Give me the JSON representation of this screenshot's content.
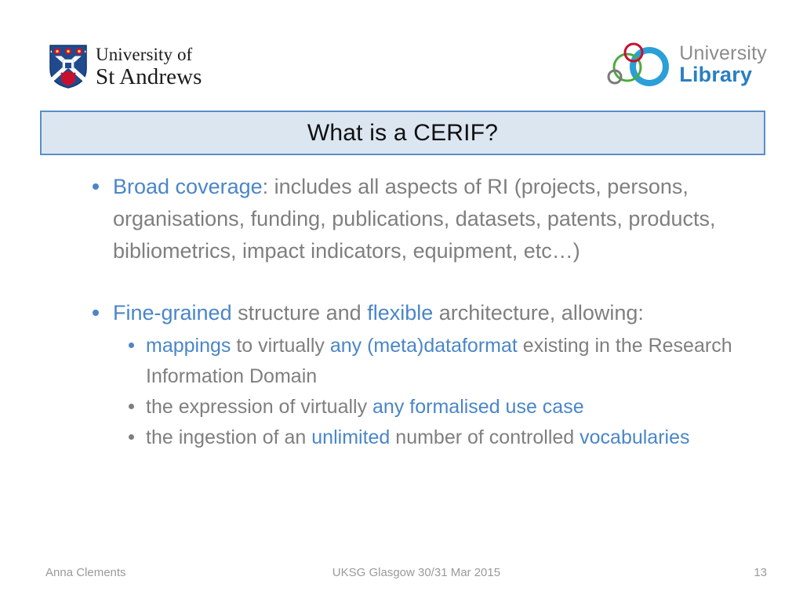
{
  "header": {
    "st_andrews": {
      "line1": "University of",
      "line2": "St Andrews",
      "crest_alt": "st-andrews-crest"
    },
    "library": {
      "line1": "University",
      "line2": "Library",
      "rings_alt": "library-rings-logo"
    }
  },
  "title": "What is a CERIF?",
  "colors": {
    "accent_blue": "#4a86c8",
    "body_grey": "#7f7f7f",
    "title_fill": "#dce6f1",
    "title_border": "#5b8dc8",
    "footer_grey": "#9a9a9a"
  },
  "content": {
    "bullet1": {
      "highlight": "Broad coverage",
      "rest": ": includes all aspects of RI (projects, persons, organisations, funding, publications, datasets, patents, products, bibliometrics, impact indicators, equipment, etc…)"
    },
    "bullet2": {
      "part1": "Fine-grained",
      "part2": " structure and ",
      "part3": "flexible",
      "part4": " architecture, allowing:"
    },
    "sub_bullets": [
      {
        "marker_color": "blue",
        "part1": "mappings",
        "part2": " to virtually ",
        "part3": "any (meta)dataformat",
        "part4": " existing in the Research Information Domain"
      },
      {
        "marker_color": "grey",
        "part1": "the expression of virtually ",
        "part2": "any formalised use case"
      },
      {
        "marker_color": "grey",
        "part1": "the ingestion of an ",
        "part2": "unlimited",
        "part3": " number of controlled ",
        "part4": "vocabularies"
      }
    ]
  },
  "footer": {
    "author": "Anna Clements",
    "event": "UKSG Glasgow 30/31 Mar 2015",
    "page_number": "13"
  }
}
